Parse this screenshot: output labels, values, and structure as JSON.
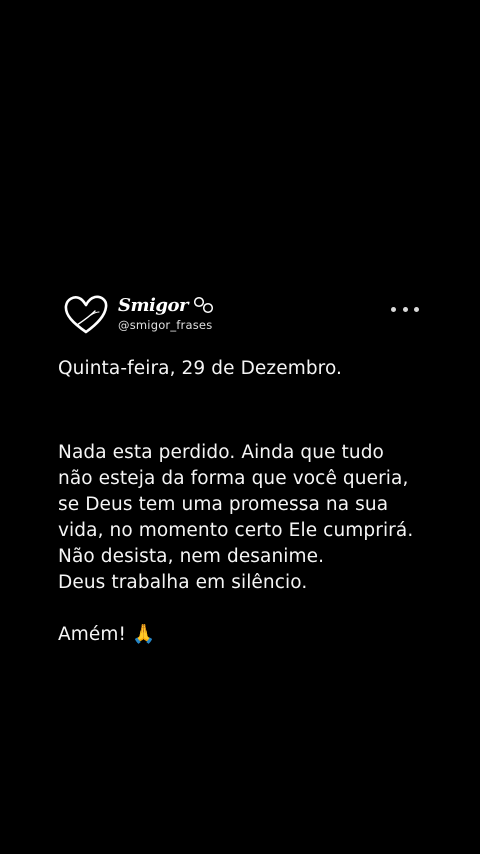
{
  "profile": {
    "display_name": "Smigor",
    "handle": "@smigor_frases",
    "avatar_icon": "heart-icon",
    "badge_icon": "link-rings-icon"
  },
  "post": {
    "date_line": "Quinta-feira, 29 de Dezembro.",
    "body_lines": [
      "Nada esta perdido. Ainda que tudo",
      "não esteja da forma que você queria,",
      "se Deus tem uma promessa na sua",
      "vida, no momento certo Ele cumprirá.",
      "Não desista, nem desanime.",
      "Deus trabalha em silêncio."
    ],
    "closing": "Amém! 🙏"
  },
  "menu": {
    "icon": "more-options-icon"
  },
  "colors": {
    "background": "#000000",
    "text": "#f5f5f5"
  }
}
